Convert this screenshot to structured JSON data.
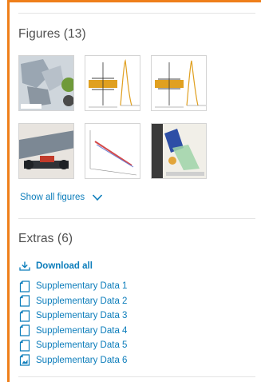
{
  "figures": {
    "title": "Figures (13)",
    "thumbnails": [
      {
        "name": "figure-thumb-1",
        "alt": "photo of rock specimens"
      },
      {
        "name": "figure-thumb-2",
        "alt": "signal waveform plot"
      },
      {
        "name": "figure-thumb-3",
        "alt": "signal waveform plot"
      },
      {
        "name": "figure-thumb-4",
        "alt": "photo of test apparatus"
      },
      {
        "name": "figure-thumb-5",
        "alt": "3d line plot"
      },
      {
        "name": "figure-thumb-6",
        "alt": "photo of instrumented specimen"
      }
    ],
    "show_all_label": "Show all figures"
  },
  "extras": {
    "title": "Extras (6)",
    "download_label": "Download all",
    "items": [
      {
        "label": "Supplementary Data 1",
        "icon": "file-icon"
      },
      {
        "label": "Supplementary Data 2",
        "icon": "file-icon"
      },
      {
        "label": "Supplementary Data 3",
        "icon": "file-icon"
      },
      {
        "label": "Supplementary Data 4",
        "icon": "file-icon"
      },
      {
        "label": "Supplementary Data 5",
        "icon": "file-icon"
      },
      {
        "label": "Supplementary Data 6",
        "icon": "image-file-icon"
      }
    ]
  },
  "colors": {
    "accent_frame": "#ef7f1a",
    "link": "#0c7dbb",
    "heading": "#505050",
    "divider": "#e4e4e4"
  }
}
